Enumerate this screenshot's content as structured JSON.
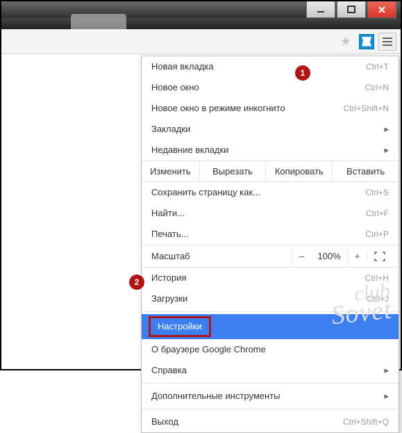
{
  "menu": {
    "new_tab": {
      "label": "Новая вкладка",
      "shortcut": "Ctrl+T"
    },
    "new_window": {
      "label": "Новое окно",
      "shortcut": "Ctrl+N"
    },
    "incognito": {
      "label": "Новое окно в режиме инкогнито",
      "shortcut": "Ctrl+Shift+N"
    },
    "bookmarks": {
      "label": "Закладки"
    },
    "recent_tabs": {
      "label": "Недавние вкладки"
    },
    "edit": {
      "label": "Изменить",
      "cut": "Вырезать",
      "copy": "Копировать",
      "paste": "Вставить"
    },
    "save_as": {
      "label": "Сохранить страницу как...",
      "shortcut": "Ctrl+S"
    },
    "find": {
      "label": "Найти...",
      "shortcut": "Ctrl+F"
    },
    "print": {
      "label": "Печать...",
      "shortcut": "Ctrl+P"
    },
    "zoom": {
      "label": "Масштаб",
      "minus": "–",
      "pct": "100%",
      "plus": "+"
    },
    "history": {
      "label": "История",
      "shortcut": "Ctrl+H"
    },
    "downloads": {
      "label": "Загрузки",
      "shortcut": "Ctrl+J"
    },
    "settings": {
      "label": "Настройки"
    },
    "about": {
      "label": "О браузере Google Chrome"
    },
    "help": {
      "label": "Справка"
    },
    "more_tools": {
      "label": "Дополнительные инструменты"
    },
    "exit": {
      "label": "Выход",
      "shortcut": "Ctrl+Shift+Q"
    }
  },
  "markers": {
    "m1": "1",
    "m2": "2"
  },
  "watermark": {
    "line1": "club",
    "line2": "Sovet"
  }
}
